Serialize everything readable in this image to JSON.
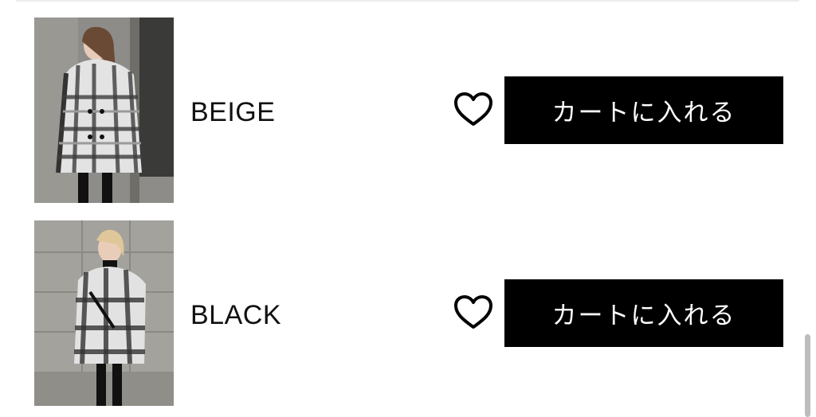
{
  "variants": [
    {
      "color_name": "BEIGE",
      "cart_label": "カートに入れる",
      "photo_icon": "product-photo-icon",
      "favorite_icon": "heart-outline-icon"
    },
    {
      "color_name": "BLACK",
      "cart_label": "カートに入れる",
      "photo_icon": "product-photo-icon",
      "favorite_icon": "heart-outline-icon"
    }
  ],
  "colors": {
    "button_bg": "#000000",
    "button_text": "#ffffff",
    "label_text": "#111111",
    "divider": "#ececec"
  }
}
